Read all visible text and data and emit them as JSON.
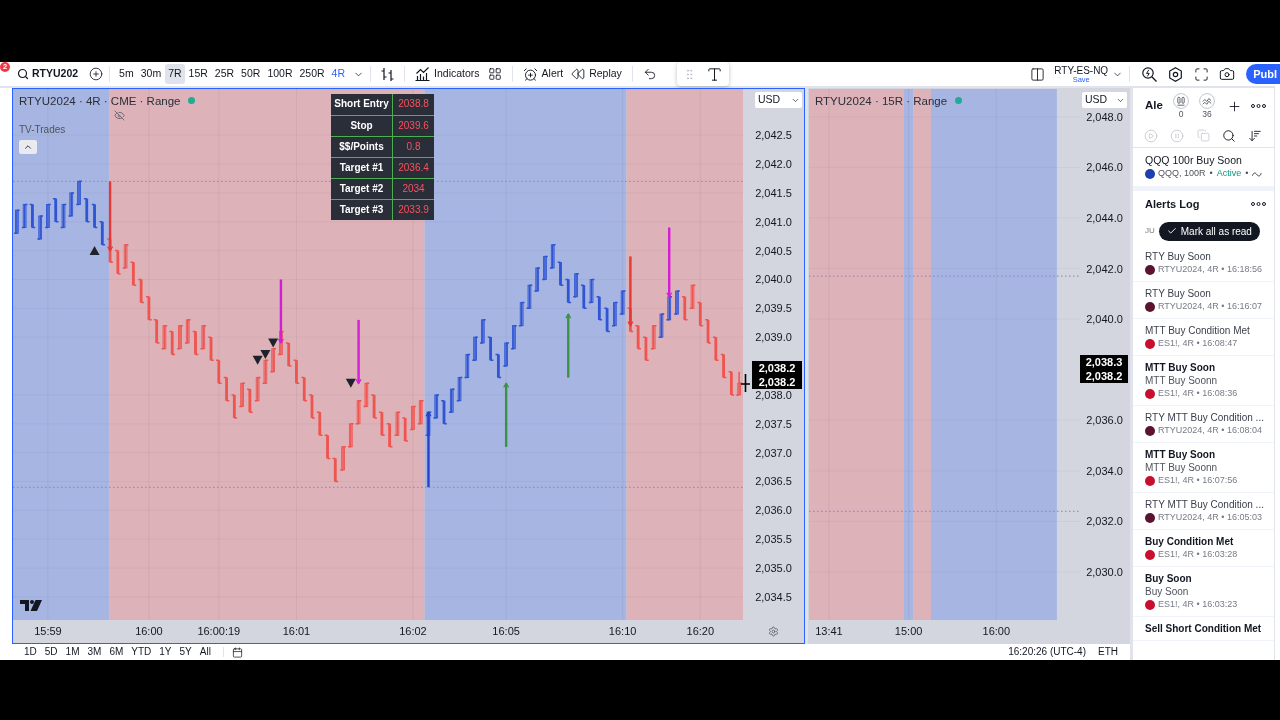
{
  "toolbar": {
    "badge": "2",
    "symbol": "RTYU202",
    "intervals": [
      {
        "label": "5m",
        "selected": false,
        "hovered": false
      },
      {
        "label": "30m",
        "selected": false,
        "hovered": false
      },
      {
        "label": "7R",
        "selected": false,
        "hovered": true
      },
      {
        "label": "15R",
        "selected": false,
        "hovered": false
      },
      {
        "label": "25R",
        "selected": false,
        "hovered": false
      },
      {
        "label": "50R",
        "selected": false,
        "hovered": false
      },
      {
        "label": "100R",
        "selected": false,
        "hovered": false
      },
      {
        "label": "250R",
        "selected": false,
        "hovered": false
      },
      {
        "label": "4R",
        "selected": true,
        "hovered": false
      }
    ],
    "tools": [
      {
        "kind": "chart_type"
      },
      {
        "kind": "indicators",
        "label": "Indicators"
      },
      {
        "kind": "templates"
      },
      {
        "kind": "alert",
        "label": "Alert"
      },
      {
        "kind": "replay",
        "label": "Replay"
      },
      {
        "kind": "undo"
      }
    ],
    "floating_tools": [
      {
        "kind": "drag"
      },
      {
        "kind": "text"
      }
    ],
    "layout": {
      "name": "RTY-ES-NQ",
      "status": "Save"
    },
    "right_tools": [
      {
        "kind": "quick_search"
      },
      {
        "kind": "settings"
      },
      {
        "kind": "fullscreen"
      },
      {
        "kind": "snapshot"
      }
    ],
    "publish": "Publ"
  },
  "charts": [
    {
      "selected": true,
      "title": "RTYU2024 · 4R · CME · Range",
      "indicator": "TV-Trades",
      "currency": "USD",
      "price_labels": [
        "2,038.2",
        "2,038.2"
      ],
      "trade_table": [
        {
          "label": "Short Entry",
          "value": "2038.8"
        },
        {
          "label": "Stop",
          "value": "2039.6"
        },
        {
          "label": "$$/Points",
          "value": "0.8"
        },
        {
          "label": "Target #1",
          "value": "2036.4"
        },
        {
          "label": "Target #2",
          "value": "2034"
        },
        {
          "label": "Target #3",
          "value": "2033.9"
        }
      ],
      "chart_data": {
        "type": "candlestick",
        "categories": [
          null,
          null,
          null,
          null,
          "15:59",
          null,
          null,
          null,
          null,
          null,
          null,
          null,
          null,
          null,
          null,
          null,
          null,
          "16:00",
          null,
          null,
          null,
          null,
          null,
          null,
          null,
          null,
          "16:00:19",
          null,
          null,
          null,
          null,
          null,
          null,
          null,
          null,
          null,
          "16:01",
          null,
          null,
          null,
          null,
          null,
          null,
          null,
          null,
          null,
          null,
          null,
          null,
          null,
          null,
          "16:02",
          null,
          null,
          null,
          null,
          null,
          null,
          null,
          null,
          null,
          null,
          null,
          "16:05",
          null,
          null,
          null,
          null,
          null,
          null,
          null,
          null,
          null,
          null,
          null,
          null,
          null,
          null,
          "16:10",
          null,
          null,
          null,
          null,
          null,
          null,
          null,
          null,
          null,
          "16:20",
          null,
          null,
          null,
          null,
          null
        ],
        "ylim": [
          2034.1,
          2043.3
        ],
        "yticks": [
          {
            "value": 2034.5,
            "label": "2,034.5"
          },
          {
            "value": 2035,
            "label": "2,035.0"
          },
          {
            "value": 2035.5,
            "label": "2,035.5"
          },
          {
            "value": 2036,
            "label": "2,036.0"
          },
          {
            "value": 2036.5,
            "label": "2,036.5"
          },
          {
            "value": 2037,
            "label": "2,037.0"
          },
          {
            "value": 2037.5,
            "label": "2,037.5"
          },
          {
            "value": 2038,
            "label": "2,038.0"
          },
          {
            "value": 2039,
            "label": "2,039.0"
          },
          {
            "value": 2039.5,
            "label": "2,039.5"
          },
          {
            "value": 2040,
            "label": "2,040.0"
          },
          {
            "value": 2040.5,
            "label": "2,040.5"
          },
          {
            "value": 2041,
            "label": "2,041.0"
          },
          {
            "value": 2041.5,
            "label": "2,041.5"
          },
          {
            "value": 2042,
            "label": "2,042.0"
          },
          {
            "value": 2042.5,
            "label": "2,042.5"
          }
        ],
        "grid": true,
        "ref_lines": [
          {
            "axis": "y",
            "value": 2041.7,
            "color": "#8e7cc3",
            "line_style": "dotted"
          },
          {
            "axis": "y",
            "value": 2036.4,
            "color": "#8e7cc3",
            "line_style": "dotted"
          }
        ],
        "ohlc": [
          [
            2040.8,
            2041.2,
            2040.8,
            2041.2
          ],
          [
            2040.9,
            2041.3,
            2040.9,
            2041.3
          ],
          [
            2041.3,
            2041.3,
            2040.9,
            2040.9
          ],
          [
            2040.7,
            2041.1,
            2040.7,
            2041.1
          ],
          [
            2040.9,
            2041.3,
            2040.9,
            2041.3
          ],
          [
            2041.4,
            2041.4,
            2041.0,
            2041.0
          ],
          [
            2040.9,
            2041.3,
            2040.9,
            2041.3
          ],
          [
            2041.1,
            2041.5,
            2041.1,
            2041.5
          ],
          [
            2041.3,
            2041.7,
            2041.3,
            2041.7
          ],
          [
            2041.4,
            2041.4,
            2041.0,
            2041.0
          ],
          [
            2041.3,
            2041.3,
            2040.9,
            2040.9
          ],
          [
            2041.0,
            2041.0,
            2040.6,
            2040.6
          ],
          [
            2040.7,
            2040.7,
            2040.3,
            2040.3
          ],
          [
            2040.5,
            2040.5,
            2040.1,
            2040.1
          ],
          [
            2040.2,
            2040.6,
            2040.2,
            2040.6
          ],
          [
            2040.3,
            2040.3,
            2039.9,
            2039.9
          ],
          [
            2040.0,
            2040.0,
            2039.6,
            2039.6
          ],
          [
            2039.7,
            2039.7,
            2039.3,
            2039.3
          ],
          [
            2039.3,
            2039.3,
            2038.9,
            2038.9
          ],
          [
            2038.8,
            2039.2,
            2038.8,
            2039.2
          ],
          [
            2039.1,
            2039.1,
            2038.7,
            2038.7
          ],
          [
            2038.8,
            2039.2,
            2038.8,
            2039.2
          ],
          [
            2038.9,
            2039.3,
            2038.9,
            2039.3
          ],
          [
            2039.1,
            2039.1,
            2038.7,
            2038.7
          ],
          [
            2038.8,
            2039.2,
            2038.8,
            2039.2
          ],
          [
            2039.0,
            2039.0,
            2038.6,
            2038.6
          ],
          [
            2038.6,
            2038.6,
            2038.2,
            2038.2
          ],
          [
            2038.3,
            2038.3,
            2037.9,
            2037.9
          ],
          [
            2038.0,
            2038.0,
            2037.6,
            2037.6
          ],
          [
            2037.8,
            2038.2,
            2037.8,
            2038.2
          ],
          [
            2038.1,
            2038.1,
            2037.7,
            2037.7
          ],
          [
            2037.9,
            2038.3,
            2037.9,
            2038.3
          ],
          [
            2038.2,
            2038.6,
            2038.2,
            2038.6
          ],
          [
            2038.4,
            2038.8,
            2038.4,
            2038.8
          ],
          [
            2038.7,
            2039.1,
            2038.7,
            2039.1
          ],
          [
            2038.9,
            2038.9,
            2038.5,
            2038.5
          ],
          [
            2038.6,
            2038.6,
            2038.2,
            2038.2
          ],
          [
            2038.3,
            2038.3,
            2037.9,
            2037.9
          ],
          [
            2038.0,
            2038.0,
            2037.6,
            2037.6
          ],
          [
            2037.7,
            2037.7,
            2037.3,
            2037.3
          ],
          [
            2037.3,
            2037.3,
            2036.9,
            2036.9
          ],
          [
            2036.9,
            2036.9,
            2036.5,
            2036.5
          ],
          [
            2036.7,
            2037.1,
            2036.7,
            2037.1
          ],
          [
            2037.1,
            2037.5,
            2037.1,
            2037.5
          ],
          [
            2037.5,
            2037.9,
            2037.5,
            2037.9
          ],
          [
            2037.8,
            2038.2,
            2037.8,
            2038.2
          ],
          [
            2038.0,
            2038.0,
            2037.6,
            2037.6
          ],
          [
            2037.7,
            2037.7,
            2037.3,
            2037.3
          ],
          [
            2037.5,
            2037.5,
            2037.1,
            2037.1
          ],
          [
            2037.3,
            2037.7,
            2037.3,
            2037.7
          ],
          [
            2037.6,
            2037.6,
            2037.2,
            2037.2
          ],
          [
            2037.4,
            2037.8,
            2037.4,
            2037.8
          ],
          [
            2037.5,
            2037.9,
            2037.5,
            2037.9
          ],
          [
            2037.3,
            2037.7,
            2037.3,
            2037.7
          ],
          [
            2037.6,
            2038.0,
            2037.6,
            2038.0
          ],
          [
            2037.9,
            2037.9,
            2037.5,
            2037.5
          ],
          [
            2037.7,
            2038.1,
            2037.7,
            2038.1
          ],
          [
            2037.9,
            2038.3,
            2037.9,
            2038.3
          ],
          [
            2038.3,
            2038.7,
            2038.3,
            2038.7
          ],
          [
            2038.6,
            2039.0,
            2038.6,
            2039.0
          ],
          [
            2038.9,
            2039.3,
            2038.9,
            2039.3
          ],
          [
            2039.0,
            2039.0,
            2038.6,
            2038.6
          ],
          [
            2038.7,
            2038.7,
            2038.3,
            2038.3
          ],
          [
            2038.5,
            2038.9,
            2038.5,
            2038.9
          ],
          [
            2038.8,
            2039.2,
            2038.8,
            2039.2
          ],
          [
            2039.2,
            2039.6,
            2039.2,
            2039.6
          ],
          [
            2039.5,
            2039.9,
            2039.5,
            2039.9
          ],
          [
            2039.8,
            2040.2,
            2039.8,
            2040.2
          ],
          [
            2040.0,
            2040.4,
            2040.0,
            2040.4
          ],
          [
            2040.2,
            2040.6,
            2040.2,
            2040.6
          ],
          [
            2040.3,
            2040.3,
            2039.9,
            2039.9
          ],
          [
            2040.0,
            2040.0,
            2039.6,
            2039.6
          ],
          [
            2039.7,
            2040.1,
            2039.7,
            2040.1
          ],
          [
            2039.9,
            2039.9,
            2039.5,
            2039.5
          ],
          [
            2039.6,
            2040.0,
            2039.6,
            2040.0
          ],
          [
            2039.7,
            2039.7,
            2039.3,
            2039.3
          ],
          [
            2039.5,
            2039.5,
            2039.1,
            2039.1
          ],
          [
            2039.2,
            2039.6,
            2039.2,
            2039.6
          ],
          [
            2039.4,
            2039.8,
            2039.4,
            2039.8
          ],
          [
            2039.5,
            2039.5,
            2039.1,
            2039.1
          ],
          [
            2039.2,
            2039.2,
            2038.8,
            2038.8
          ],
          [
            2039.0,
            2039.0,
            2038.6,
            2038.6
          ],
          [
            2038.8,
            2039.2,
            2038.8,
            2039.2
          ],
          [
            2039.0,
            2039.4,
            2039.0,
            2039.4
          ],
          [
            2039.3,
            2039.7,
            2039.3,
            2039.7
          ],
          [
            2039.4,
            2039.8,
            2039.4,
            2039.8
          ],
          [
            2039.7,
            2039.7,
            2039.3,
            2039.3
          ],
          [
            2039.5,
            2039.9,
            2039.5,
            2039.9
          ],
          [
            2039.6,
            2039.6,
            2039.2,
            2039.2
          ],
          [
            2039.3,
            2039.3,
            2038.9,
            2038.9
          ],
          [
            2039.0,
            2039.0,
            2038.6,
            2038.6
          ],
          [
            2038.7,
            2038.7,
            2038.3,
            2038.3
          ],
          [
            2038.4,
            2038.4,
            2038.0,
            2038.0
          ],
          [
            2038.0,
            2038.4,
            2038.0,
            2038.2
          ]
        ],
        "colors": [
          "#2f54d4",
          "#2f54d4",
          "#2f54d4",
          "#2f54d4",
          "#2f54d4",
          "#2f54d4",
          "#2f54d4",
          "#2f54d4",
          "#2f54d4",
          "#2f54d4",
          "#2f54d4",
          "#2f54d4",
          "#f0544f",
          "#f0544f",
          "#f0544f",
          "#f0544f",
          "#f0544f",
          "#f0544f",
          "#f0544f",
          "#f0544f",
          "#f0544f",
          "#f0544f",
          "#f0544f",
          "#f0544f",
          "#f0544f",
          "#f0544f",
          "#f0544f",
          "#f0544f",
          "#f0544f",
          "#f0544f",
          "#f0544f",
          "#f0544f",
          "#f0544f",
          "#f0544f",
          "#f0544f",
          "#f0544f",
          "#f0544f",
          "#f0544f",
          "#f0544f",
          "#f0544f",
          "#f0544f",
          "#f0544f",
          "#f0544f",
          "#f0544f",
          "#f0544f",
          "#f0544f",
          "#f0544f",
          "#f0544f",
          "#f0544f",
          "#f0544f",
          "#f0544f",
          "#f0544f",
          "#f0544f",
          "#2f54d4",
          "#2f54d4",
          "#2f54d4",
          "#2f54d4",
          "#2f54d4",
          "#2f54d4",
          "#2f54d4",
          "#2f54d4",
          "#2f54d4",
          "#2f54d4",
          "#2f54d4",
          "#2f54d4",
          "#2f54d4",
          "#2f54d4",
          "#2f54d4",
          "#2f54d4",
          "#2f54d4",
          "#2f54d4",
          "#2f54d4",
          "#2f54d4",
          "#2f54d4",
          "#2f54d4",
          "#2f54d4",
          "#2f54d4",
          "#2f54d4",
          "#2f54d4",
          "#f0544f",
          "#f0544f",
          "#f0544f",
          "#f0544f",
          "#2f54d4",
          "#2f54d4",
          "#2f54d4",
          "#f0544f",
          "#f0544f",
          "#f0544f",
          "#f0544f",
          "#f0544f",
          "#f0544f",
          "#f0544f",
          "#f0544f"
        ]
      }
    },
    {
      "selected": false,
      "title": "RTYU2024 · 15R · Range",
      "currency": "USD",
      "price_labels": [
        "2,038.3",
        "2,038.2"
      ],
      "chart_data": {
        "type": "candlestick",
        "categories": [
          null,
          null,
          "13:41",
          null,
          null,
          null,
          null,
          null,
          null,
          null,
          null,
          null,
          "15:00",
          null,
          null,
          null,
          null,
          null,
          null,
          null,
          null,
          null,
          null,
          "16:00",
          null,
          null,
          null,
          null,
          null,
          null,
          null,
          null,
          null,
          null
        ],
        "ylim": [
          2028.1,
          2049.1
        ],
        "yticks": [
          {
            "value": 2030,
            "label": "2,030.0"
          },
          {
            "value": 2032,
            "label": "2,032.0"
          },
          {
            "value": 2034,
            "label": "2,034.0"
          },
          {
            "value": 2036,
            "label": "2,036.0"
          },
          {
            "value": 2040,
            "label": "2,040.0"
          },
          {
            "value": 2042,
            "label": "2,042.0"
          },
          {
            "value": 2044,
            "label": "2,044.0"
          },
          {
            "value": 2046,
            "label": "2,046.0"
          },
          {
            "value": 2048,
            "label": "2,048.0"
          }
        ],
        "grid": true,
        "ref_lines": [
          {
            "axis": "y",
            "value": 2041.7,
            "color": "#8e7cc3",
            "line_style": "dotted"
          },
          {
            "axis": "y",
            "value": 2032.4,
            "color": "#8e7cc3",
            "line_style": "dotted"
          }
        ]
      }
    }
  ],
  "bottom_bar": {
    "ranges": [
      "1D",
      "5D",
      "1M",
      "3M",
      "6M",
      "YTD",
      "1Y",
      "5Y",
      "All"
    ],
    "time": "16:20:26 (UTC-4)",
    "session": "ETH"
  },
  "alerts": {
    "title": "Ale",
    "counters": [
      {
        "kind": "paused",
        "count": "0"
      },
      {
        "kind": "triggered",
        "count": "36"
      }
    ],
    "header_tools": [
      {
        "kind": "add"
      },
      {
        "kind": "more"
      }
    ],
    "tools": [
      {
        "kind": "play",
        "disabled": true
      },
      {
        "kind": "pause",
        "disabled": true
      },
      {
        "kind": "copy",
        "disabled": true
      },
      {
        "kind": "search",
        "disabled": false
      },
      {
        "kind": "sort",
        "disabled": false
      }
    ],
    "active_alert": {
      "title": "QQQ 100r Buy Soon",
      "color": "#1e3fae",
      "parts": [
        {
          "kind": "symbol",
          "text": "QQQ, 100R"
        },
        {
          "kind": "separator",
          "text": "•"
        },
        {
          "kind": "status",
          "text": "Active"
        },
        {
          "kind": "separator",
          "text": "•"
        }
      ]
    },
    "log": {
      "title": "Alerts Log",
      "date": "JU",
      "mark_all": "Mark all as read",
      "entries": [
        {
          "title": "RTY Buy Soon",
          "unread": false,
          "color": "#5a1430",
          "details": "RTYU2024, 4R • 16:18:56"
        },
        {
          "title": "RTY Buy Soon",
          "unread": false,
          "color": "#5a1430",
          "details": "RTYU2024, 4R • 16:16:07"
        },
        {
          "title": "MTT Buy Condition Met",
          "unread": false,
          "color": "#c8102e",
          "details": "ES1!, 4R • 16:08:47"
        },
        {
          "title": "MTT Buy Soon",
          "unread": true,
          "message": "MTT Buy Soonn",
          "color": "#c8102e",
          "details": "ES1!, 4R • 16:08:36"
        },
        {
          "title": "RTY MTT Buy Condition ...",
          "unread": false,
          "color": "#5a1430",
          "details": "RTYU2024, 4R • 16:08:04"
        },
        {
          "title": "MTT Buy Soon",
          "unread": true,
          "message": "MTT Buy Soonn",
          "color": "#c8102e",
          "details": "ES1!, 4R • 16:07:56"
        },
        {
          "title": "RTY MTT Buy Condition ...",
          "unread": false,
          "color": "#5a1430",
          "details": "RTYU2024, 4R • 16:05:03"
        },
        {
          "title": "Buy Condition Met",
          "unread": true,
          "color": "#c8102e",
          "details": "ES1!, 4R • 16:03:28"
        },
        {
          "title": "Buy Soon",
          "unread": true,
          "message": "Buy Soon",
          "color": "#c8102e",
          "details": "ES1!, 4R • 16:03:23"
        },
        {
          "title": "Sell Short Condition Met",
          "unread": true
        }
      ]
    }
  }
}
